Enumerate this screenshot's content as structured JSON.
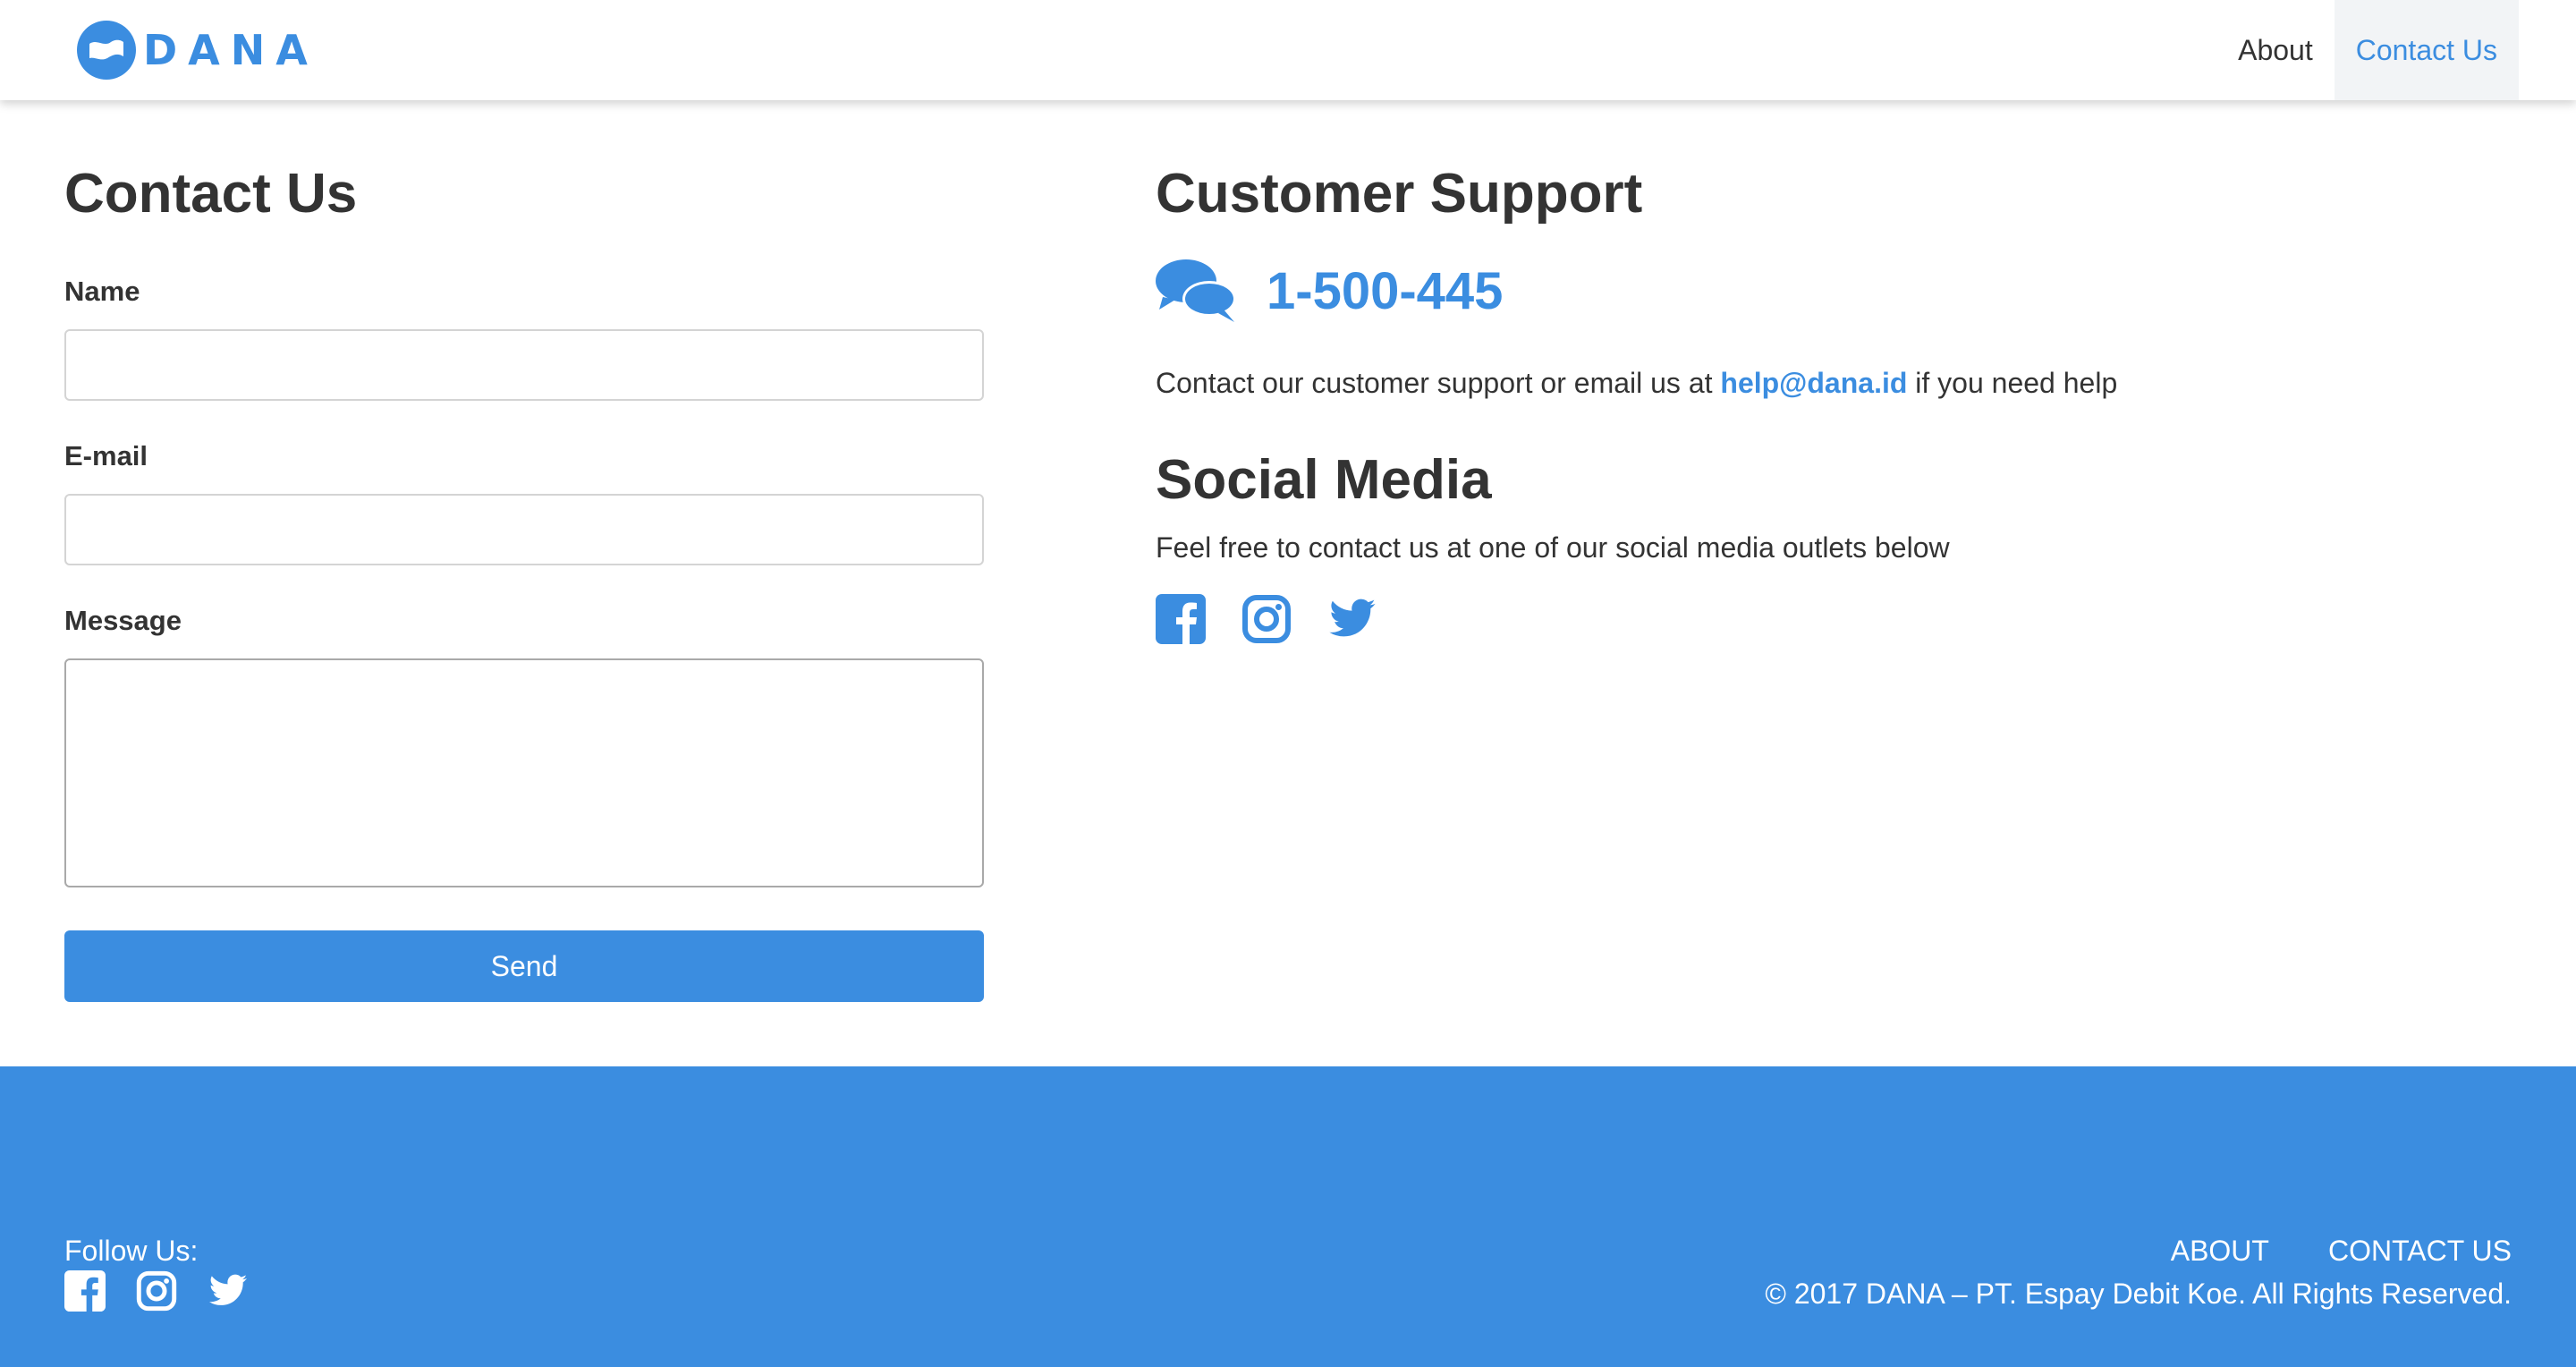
{
  "brand": {
    "name": "DANA",
    "color": "#3b8de0"
  },
  "nav": {
    "items": [
      "About",
      "Contact Us"
    ],
    "active": "Contact Us"
  },
  "contact_form": {
    "title": "Contact Us",
    "name_label": "Name",
    "name_value": "",
    "email_label": "E-mail",
    "email_value": "",
    "message_label": "Message",
    "message_value": "",
    "send_label": "Send"
  },
  "customer_support": {
    "title": "Customer Support",
    "icon": "chat-bubbles-icon",
    "phone": "1-500-445",
    "text_before": "Contact our customer support or email us at ",
    "email": "help@dana.id",
    "text_after": " if you need help"
  },
  "social_media": {
    "title": "Social Media",
    "text": "Feel free to contact us at one of our social media outlets below",
    "icons": [
      "facebook-icon",
      "instagram-icon",
      "twitter-icon"
    ]
  },
  "footer": {
    "follow_label": "Follow Us:",
    "links": [
      "ABOUT",
      "CONTACT US"
    ],
    "copyright": "© 2017 DANA – PT. Espay Debit Koe. All Rights Reserved.",
    "background": "#3b8de0"
  }
}
